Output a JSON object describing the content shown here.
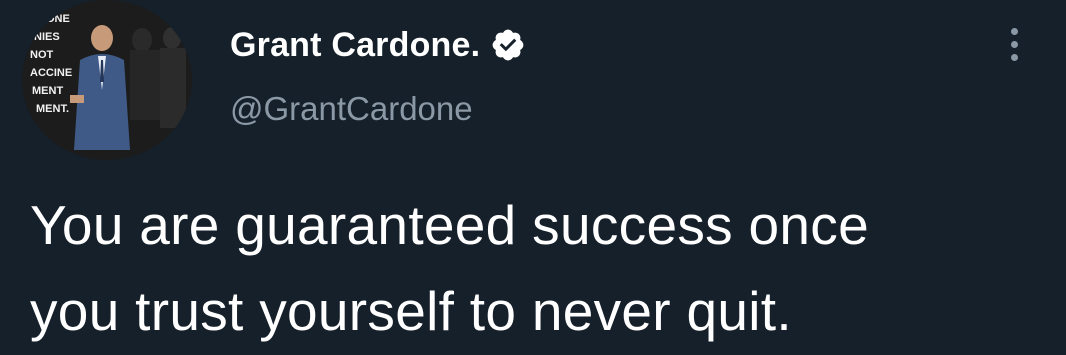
{
  "author": {
    "display_name": "Grant Cardone.",
    "handle": "@GrantCardone",
    "verified": true,
    "verified_color": "#ffffff",
    "avatar_overlay_text": [
      "DONE",
      "NIES",
      "NOT",
      "ACCINE",
      "MENT",
      "MENT."
    ]
  },
  "tweet": {
    "text_lines": [
      "You are guaranteed success once",
      "you trust yourself to never quit."
    ]
  },
  "icons": {
    "more": "more-vertical-icon",
    "verified": "verified-badge-icon"
  },
  "colors": {
    "background": "#15202b",
    "text_primary": "#ffffff",
    "text_secondary": "#8b98a5"
  }
}
